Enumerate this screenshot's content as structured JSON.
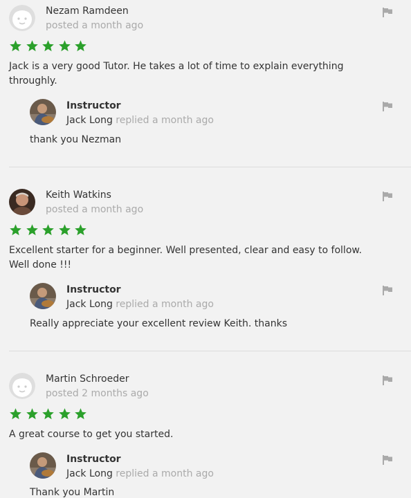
{
  "colors": {
    "star": "#2ba02b",
    "muted": "#aaaaaa",
    "text": "#333333",
    "flag": "#aaaaaa"
  },
  "reviews": [
    {
      "name": "Nezam Ramdeen",
      "posted": "posted a month ago",
      "avatar": "default-avatar-icon",
      "rating": 5,
      "text": "Jack is a very good Tutor. He takes a lot of time to explain everything throughly.",
      "reply": {
        "role": "Instructor",
        "author": "Jack Long",
        "when": "replied a month ago",
        "text": "thank you Nezman"
      }
    },
    {
      "name": "Keith Watkins",
      "posted": "posted a month ago",
      "avatar": "user-photo",
      "rating": 5,
      "text": "Excellent starter for a beginner. Well presented, clear and easy to follow. Well done !!!",
      "reply": {
        "role": "Instructor",
        "author": "Jack Long",
        "when": "replied a month ago",
        "text": "Really appreciate your excellent review Keith. thanks"
      }
    },
    {
      "name": "Martin Schroeder",
      "posted": "posted 2 months ago",
      "avatar": "default-avatar-icon",
      "rating": 5,
      "text": "A great course to get you started.",
      "reply": {
        "role": "Instructor",
        "author": "Jack Long",
        "when": "replied a month ago",
        "text": "Thank you Martin"
      }
    }
  ]
}
